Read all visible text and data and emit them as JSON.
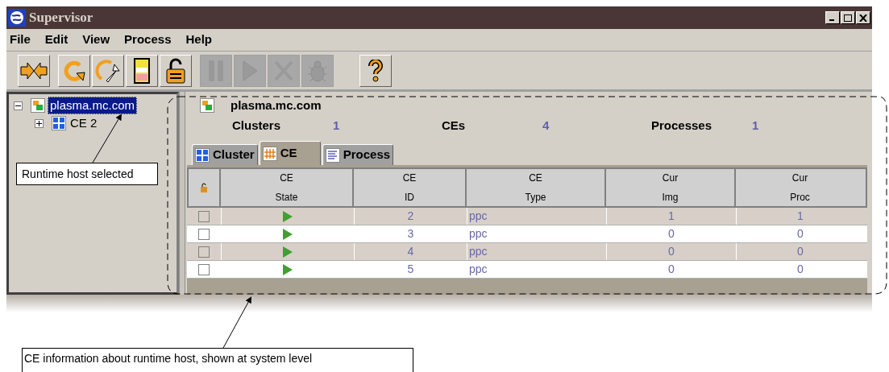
{
  "window": {
    "title": "Supervisor"
  },
  "menu": [
    "File",
    "Edit",
    "View",
    "Process",
    "Help"
  ],
  "toolbar_groups": [
    [
      {
        "kind": "connect",
        "disabled": false
      }
    ],
    [
      {
        "kind": "refresh",
        "disabled": false
      },
      {
        "kind": "refresh-all",
        "disabled": false
      },
      {
        "kind": "save",
        "disabled": false
      },
      {
        "kind": "lock",
        "disabled": false
      }
    ],
    [
      {
        "kind": "pause",
        "disabled": true
      },
      {
        "kind": "play",
        "disabled": true
      },
      {
        "kind": "stop",
        "disabled": true
      },
      {
        "kind": "debug",
        "disabled": true
      }
    ],
    [
      {
        "kind": "help",
        "disabled": false
      }
    ]
  ],
  "tree": [
    {
      "label": "plasma.mc.com",
      "kind": "host",
      "expanded": true,
      "selected": true,
      "children": [
        {
          "label": "CE 2",
          "kind": "cluster",
          "expanded": false,
          "selected": false
        }
      ]
    }
  ],
  "detail": {
    "title": "plasma.mc.com",
    "stats": [
      {
        "label": "Clusters",
        "value": "1"
      },
      {
        "label": "CEs",
        "value": "4"
      },
      {
        "label": "Processes",
        "value": "1"
      }
    ],
    "tabs": [
      {
        "label": "Cluster",
        "kind": "cluster",
        "selected": false
      },
      {
        "label": "CE",
        "kind": "ce",
        "selected": true
      },
      {
        "label": "Process",
        "kind": "process",
        "selected": false
      }
    ],
    "table": {
      "columns": [
        {
          "top": "CE",
          "bottom": "State"
        },
        {
          "top": "CE",
          "bottom": "ID"
        },
        {
          "top": "CE",
          "bottom": "Type"
        },
        {
          "top": "Cur",
          "bottom": "Img"
        },
        {
          "top": "Cur",
          "bottom": "Proc"
        }
      ],
      "rows": [
        {
          "checked": false,
          "kind": "running",
          "id": "2",
          "type": "ppc",
          "cur_img": "1",
          "cur_proc": "1"
        },
        {
          "checked": false,
          "kind": "running",
          "id": "3",
          "type": "ppc",
          "cur_img": "0",
          "cur_proc": "0"
        },
        {
          "checked": false,
          "kind": "running",
          "id": "4",
          "type": "ppc",
          "cur_img": "0",
          "cur_proc": "0"
        },
        {
          "checked": false,
          "kind": "running",
          "id": "5",
          "type": "ppc",
          "cur_img": "0",
          "cur_proc": "0"
        }
      ]
    }
  },
  "annotations": [
    {
      "text": "Runtime host selected"
    },
    {
      "text": "CE information about runtime host, shown at system level"
    }
  ]
}
